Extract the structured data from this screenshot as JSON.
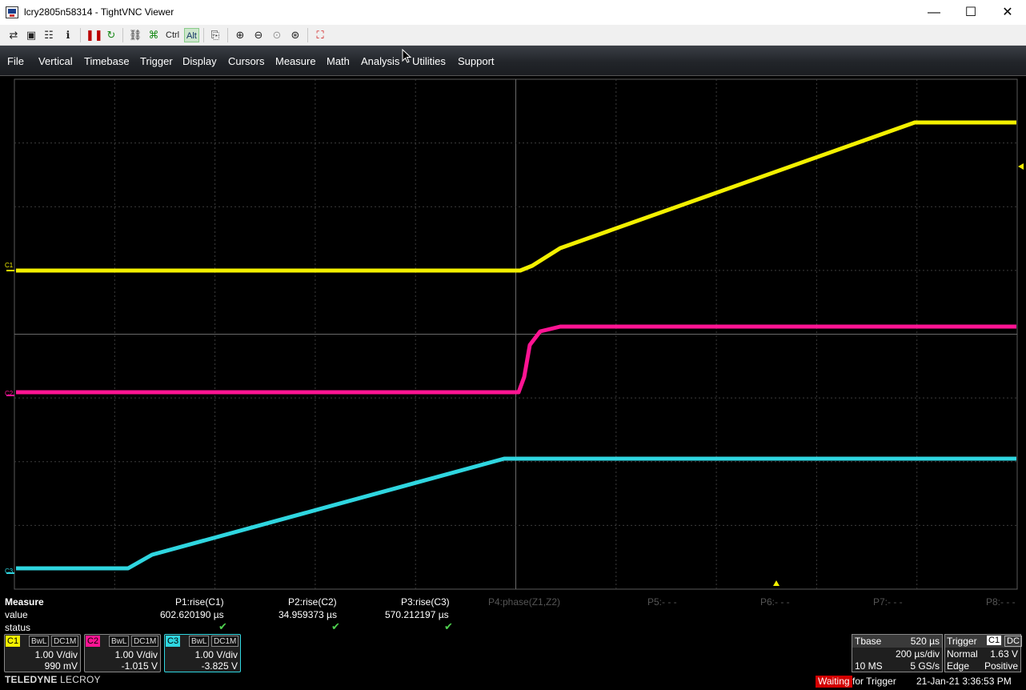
{
  "window": {
    "title": "lcry2805n58314 - TightVNC Viewer",
    "min_glyph": "—",
    "max_glyph": "☐",
    "close_glyph": "✕"
  },
  "toolbar": {
    "ctrl_label": "Ctrl",
    "alt_label": "Alt",
    "icons": [
      "new-connection-icon",
      "save-icon",
      "options-icon",
      "info-icon",
      "pause-icon",
      "refresh-icon",
      "transfer-icon",
      "ctrl-key-icon",
      "alt-key-icon",
      "clipboard-icon",
      "zoom-in-icon",
      "zoom-out-icon",
      "zoom-100-icon",
      "zoom-auto-icon",
      "fullscreen-icon"
    ]
  },
  "menu": {
    "items": [
      "File",
      "Vertical",
      "Timebase",
      "Trigger",
      "Display",
      "Cursors",
      "Measure",
      "Math",
      "Analysis",
      "Utilities",
      "Support"
    ]
  },
  "traces": {
    "c1_label": "C1",
    "c2_label": "C2",
    "c3_label": "C3",
    "c1_color": "#f3f000",
    "c2_color": "#ff1493",
    "c3_color": "#2fd6e0"
  },
  "measure": {
    "title": "Measure",
    "row_value": "value",
    "row_status": "status",
    "params": [
      {
        "label": "P1:rise(C1)",
        "value": "602.620190 µs",
        "ok": true
      },
      {
        "label": "P2:rise(C2)",
        "value": "34.959373 µs",
        "ok": true
      },
      {
        "label": "P3:rise(C3)",
        "value": "570.212197 µs",
        "ok": true
      },
      {
        "label": "P4:phase(Z1,Z2)",
        "value": "",
        "ok": false
      },
      {
        "label": "P5:- - -",
        "value": "",
        "ok": false
      },
      {
        "label": "P6:- - -",
        "value": "",
        "ok": false
      },
      {
        "label": "P7:- - -",
        "value": "",
        "ok": false
      },
      {
        "label": "P8:- - -",
        "value": "",
        "ok": false
      }
    ],
    "check_glyph": "✔"
  },
  "channels": [
    {
      "tag": "C1",
      "bwl": "BwL",
      "coupling": "DC1M",
      "vdiv": "1.00 V/div",
      "offset": "990 mV",
      "color": "#f3f000"
    },
    {
      "tag": "C2",
      "bwl": "BwL",
      "coupling": "DC1M",
      "vdiv": "1.00 V/div",
      "offset": "-1.015 V",
      "color": "#ff1493"
    },
    {
      "tag": "C3",
      "bwl": "BwL",
      "coupling": "DC1M",
      "vdiv": "1.00 V/div",
      "offset": "-3.825 V",
      "color": "#2fd6e0"
    }
  ],
  "timebase": {
    "label": "Tbase",
    "delay": "520 µs",
    "per_div": "200 µs/div",
    "memory": "10 MS",
    "rate": "5 GS/s"
  },
  "trigger": {
    "label": "Trigger",
    "source": "C1",
    "coupling": "DC",
    "mode": "Normal",
    "level": "1.63 V",
    "type": "Edge",
    "slope": "Positive"
  },
  "brand": {
    "name": "TELEDYNE",
    "sub": "LECROY"
  },
  "status": {
    "waiting": "Waiting",
    "for_trigger": "for Trigger",
    "datetime": "21-Jan-21 3:36:53 PM"
  }
}
